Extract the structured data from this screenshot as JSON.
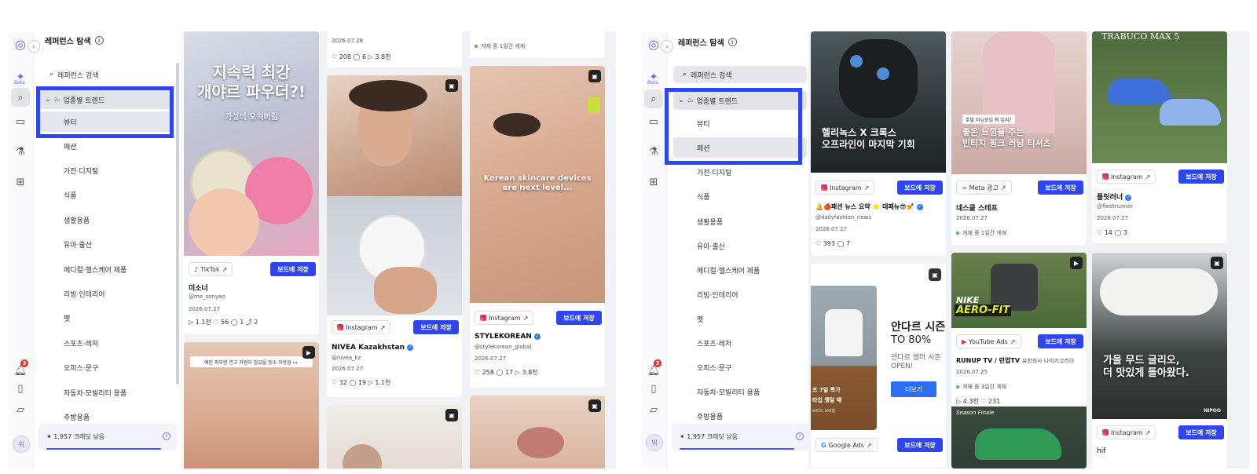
{
  "sidebar": {
    "title": "레퍼런스 탐색",
    "beta": "Beta",
    "notification_count": "3",
    "avatar": "위",
    "search_label": "레퍼런스 검색",
    "trend_label": "업종별 트렌드",
    "categories": [
      "뷰티",
      "패션",
      "가전·디지털",
      "식품",
      "생활용품",
      "유아·출산",
      "메디컬·헬스케어 제품",
      "리빙·인테리어",
      "펫",
      "스포츠·레저",
      "오피스·문구",
      "자동차·모빌리티 용품",
      "주방용품"
    ],
    "credits": "1,957 크레딧 남음"
  },
  "common": {
    "save_label": "보드에 저장"
  },
  "left_feed": {
    "card1": {
      "overlay_title": "지속력 최강\n개야르 파우더?!",
      "overlay_sub": "가성비 오쳐버림",
      "platform": "TikTok",
      "name": "미소너",
      "handle": "@me_sonyeo",
      "date": "2026.07.27",
      "stats": "▷ 1.1천   ♡ 56   ◯ 1   ⤴ 2"
    },
    "card2": {
      "overlay": "예민 피부엔 연고 처럼이 많았을 등소 처방함 👀",
      "play_icon": "▶"
    },
    "card3": {
      "handle_top": "@nivea.kazakhstan",
      "date_top": "2026.07.28",
      "stats_top": "♡ 208   ◯ 6   ▷ 3.8천",
      "platform": "Instagram",
      "name": "NIVEA Kazakhstan",
      "handle": "@nivea_kz",
      "date": "2026.07.27",
      "stats": "♡ 32   ◯ 19   ▷ 1.1천"
    },
    "card4": {
      "date_top": "2026.07.27",
      "status_top": "게재 중    1일간 게재",
      "overlay": "Korean skincare devices\nare next level...",
      "platform": "Instagram",
      "name": "STYLEKOREAN",
      "handle": "@stylekorean_global",
      "date": "2026.07.27",
      "stats": "♡ 258   ◯ 17   ▷ 3.8천"
    }
  },
  "right_feed": {
    "card1": {
      "overlay": "헬리녹스 X 크록스\n오프라인이 마지막 기회",
      "platform": "Instagram",
      "name": "🔔🍎패션 뉴스 요약 ⭐ 데패뉴😎💅",
      "handle": "@dailyfashion_news",
      "date": "2026.07.27",
      "stats": "♡ 393   ◯ 7"
    },
    "card2": {
      "overlay_tag": "주말 러닝모임 뭐 입지?",
      "overlay": "좋은 느낌을 주는\n빈티지 핑크 러닝 티셔츠",
      "platform": "Meta 광고",
      "name": "네스클 스테프",
      "date": "2026.07.27",
      "status": "게재 중    1일간 게재"
    },
    "card3": {
      "overlay": "TRABUCO MAX 5",
      "platform": "Instagram",
      "name": "플릿러너",
      "handle": "@fleetrunner",
      "date": "2026.07.27",
      "stats": "♡ 14   ◯ 3"
    },
    "card4": {
      "headline": "안다르 시즌",
      "headline2": "TO 80%",
      "sub": "안다르 썸머 시즌",
      "sub2": "OPEN!",
      "cta": "더보기",
      "promo1": "프 7일 특가",
      "promo2": "타입 챙일 때",
      "promo3": "브라드 브라함",
      "platform": "Google Ads"
    },
    "card5": {
      "logo": "NIKE",
      "logo2": "AERO-FIT",
      "platform": "YouTube Ads",
      "name": "RUNUP TV / 런업TV",
      "name_suffix": "유한회사 나이키코리아",
      "date": "2026.07.25",
      "status": "게재 중    3일간 게재",
      "stats": "▷ 4.3천   ♡ 231",
      "bottom_label": "Season Finale"
    },
    "card6": {
      "overlay": "가을 무드 글리오,\n더 맛있게 돌아왔다.",
      "brand": "NIPOO",
      "platform": "Instagram",
      "name": "hif"
    }
  },
  "colors": {
    "accent": "#2f45f0",
    "highlight": "#2f45f0",
    "badge": "#e5322d"
  }
}
